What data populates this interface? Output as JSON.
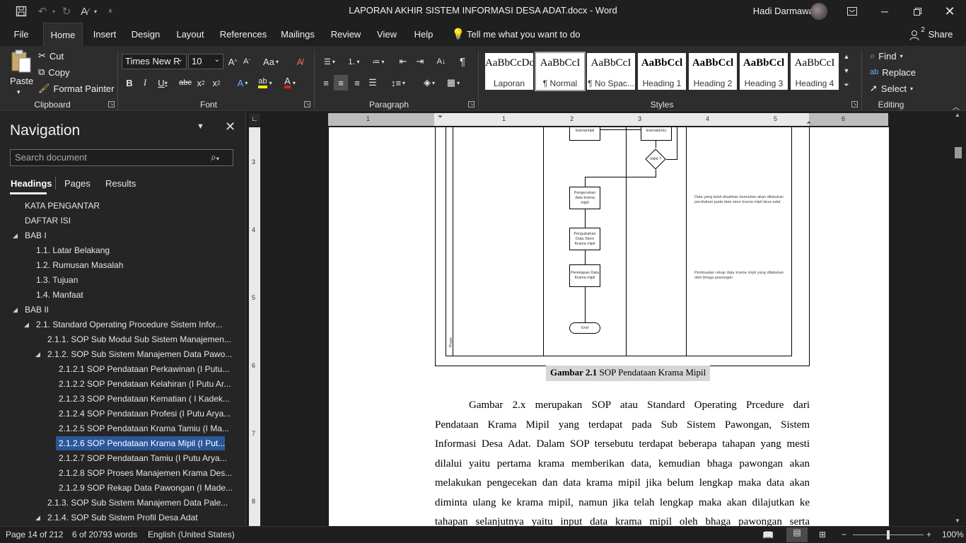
{
  "window": {
    "title": "LAPORAN AKHIR SISTEM INFORMASI DESA ADAT.docx  -  Word",
    "user": "Hadi Darmawan"
  },
  "tabs": [
    "File",
    "Home",
    "Insert",
    "Design",
    "Layout",
    "References",
    "Mailings",
    "Review",
    "View",
    "Help"
  ],
  "tell_me": "Tell me what you want to do",
  "share": "Share",
  "share_count": "2",
  "clipboard": {
    "paste": "Paste",
    "cut": "Cut",
    "copy": "Copy",
    "format_painter": "Format Painter",
    "label": "Clipboard"
  },
  "font": {
    "name": "Times New R",
    "size": "10",
    "label": "Font",
    "case": "Aa"
  },
  "paragraph": {
    "label": "Paragraph"
  },
  "styles": {
    "label": "Styles",
    "items": [
      {
        "sample": "AaBbCcDc",
        "name": "Laporan"
      },
      {
        "sample": "AaBbCcI",
        "name": "¶ Normal"
      },
      {
        "sample": "AaBbCcI",
        "name": "¶ No Spac..."
      },
      {
        "sample": "AaBbCcl",
        "name": "Heading 1"
      },
      {
        "sample": "AaBbCcl",
        "name": "Heading 2"
      },
      {
        "sample": "AaBbCcl",
        "name": "Heading 3"
      },
      {
        "sample": "AaBbCcI",
        "name": "Heading 4"
      }
    ]
  },
  "editing": {
    "label": "Editing",
    "find": "Find",
    "replace": "Replace",
    "select": "Select"
  },
  "navigation": {
    "title": "Navigation",
    "search_placeholder": "Search document",
    "tabs": [
      "Headings",
      "Pages",
      "Results"
    ],
    "items": [
      {
        "text": "KATA PENGANTAR"
      },
      {
        "text": "DAFTAR ISI"
      },
      {
        "text": "BAB I"
      },
      {
        "text": "1.1. Latar Belakang"
      },
      {
        "text": "1.2. Rumusan Masalah"
      },
      {
        "text": "1.3. Tujuan"
      },
      {
        "text": "1.4. Manfaat"
      },
      {
        "text": "BAB II"
      },
      {
        "text": "2.1. Standard Operating Procedure Sistem Infor..."
      },
      {
        "text": "2.1.1. SOP Sub Modul Sub Sistem Manajemen..."
      },
      {
        "text": "2.1.2. SOP Sub Sistem Manajemen Data Pawo..."
      },
      {
        "text": "2.1.2.1 SOP Pendataan Perkawinan (I Putu..."
      },
      {
        "text": "2.1.2.2 SOP Pendataan Kelahiran (I Putu Ar..."
      },
      {
        "text": "2.1.2.3 SOP Pendataan Kematian  ( I Kadek..."
      },
      {
        "text": "2.1.2.4 SOP Pendataan Profesi (I Putu Arya..."
      },
      {
        "text": "2.1.2.5 SOP Pendataan Krama Tamiu (I Ma..."
      },
      {
        "text": "2.1.2.6 SOP Pendataan Krama Mipil  (I Put..."
      },
      {
        "text": "2.1.2.7 SOP Pendataan Tamiu (I Putu Arya..."
      },
      {
        "text": "2.1.2.8 SOP Proses Manajemen Krama Des..."
      },
      {
        "text": "2.1.2.9 SOP Rekap Data Pawongan (I Made..."
      },
      {
        "text": "2.1.3. SOP Sub Sistem Manajemen Data Pale..."
      },
      {
        "text": "2.1.4. SOP Sub Sistem Profil Desa Adat"
      }
    ]
  },
  "ruler_h": [
    "1",
    "1",
    "2",
    "3",
    "4",
    "5",
    "6"
  ],
  "ruler_v": [
    "3",
    "4",
    "5",
    "6",
    "7",
    "8"
  ],
  "figure": {
    "boxes": {
      "top_left": "kramamipil",
      "top_right": "kramatamiu",
      "decision": "Valid ?",
      "b1": "Pengecekan data krama mipil",
      "b2": "Pengubahan Data Store Krama mipil",
      "b3": "Perekapan Data Krama mipil",
      "end": "End",
      "phase": "Phase"
    },
    "annotations": [
      "Data yang telah disahkan kemudian akan dilakukan perubahan pada data store krama mipil desa adat",
      "Pembuatan rekap data krama mipil yang dilakukan oleh bhaga pawongan"
    ]
  },
  "caption": {
    "bold": "Gambar 2.1",
    "text": " SOP Pendataan Krama Mipil"
  },
  "paragraph_lines": [
    "Gambar 2.x merupakan SOP atau Standard Operating Prcedure dari",
    "Pendataan Krama Mipil yang terdapat pada Sub Sistem Pawongan, Sistem",
    "Informasi Desa Adat. Dalam SOP tersebutu terdapat beberapa tahapan yang mesti",
    "dilalui yaitu pertama krama memberikan data, kemudian bhaga pawongan akan",
    "melakukan pengecekan dan data krama mipil jika belum lengkap maka data akan",
    "diminta ulang ke krama mipil, namun jika telah lengkap maka akan dilajutkan ke",
    "tahapan selanjutnya yaitu input data krama mipil oleh bhaga pawongan serta"
  ],
  "status": {
    "page": "Page 14 of 212",
    "words": "6 of 20793 words",
    "language": "English (United States)",
    "zoom": "100%"
  }
}
